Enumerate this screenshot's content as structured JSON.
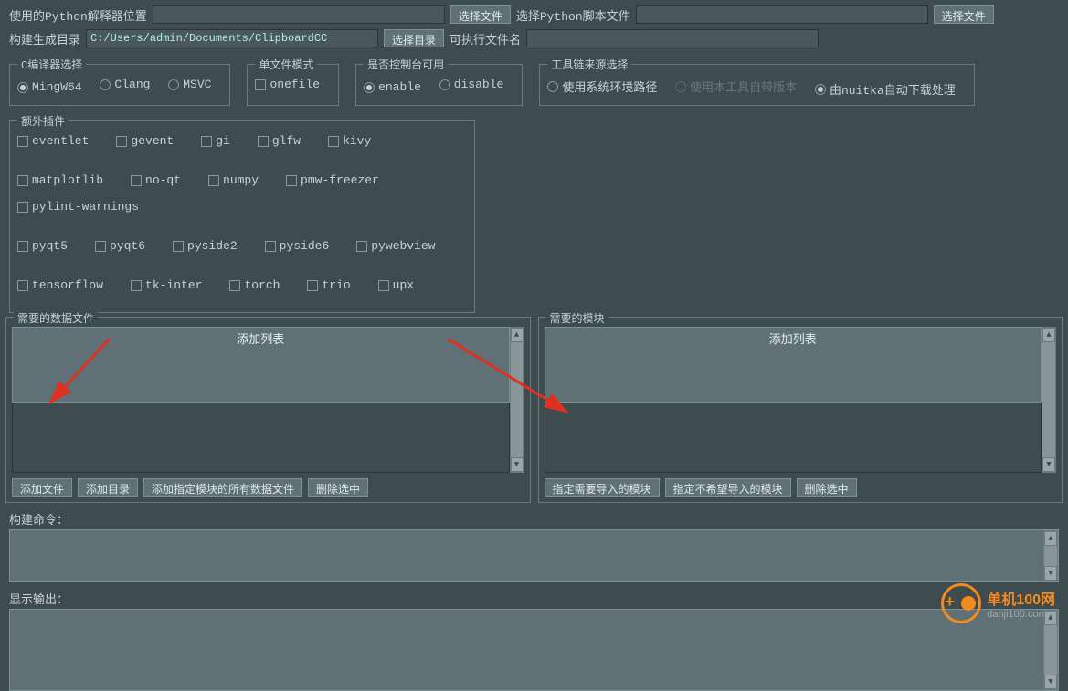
{
  "row1": {
    "python_interp_label": "使用的Python解释器位置",
    "python_interp_value": "",
    "select_file_btn": "选择文件",
    "python_script_label": "选择Python脚本文件",
    "python_script_value": "",
    "select_file_btn2": "选择文件"
  },
  "row2": {
    "build_dir_label": "构建生成目录",
    "build_dir_value": "C:/Users/admin/Documents/ClipboardCC",
    "select_dir_btn": "选择目录",
    "exe_name_label": "可执行文件名",
    "exe_name_value": ""
  },
  "compiler": {
    "legend": "C编译器选择",
    "options": [
      "MingW64",
      "Clang",
      "MSVC"
    ],
    "selected": "MingW64"
  },
  "single_file": {
    "legend": "单文件模式",
    "option": "onefile",
    "checked": false
  },
  "console": {
    "legend": "是否控制台可用",
    "options": [
      "enable",
      "disable"
    ],
    "selected": "enable"
  },
  "toolchain": {
    "legend": "工具链来源选择",
    "opt1": "使用系统环境路径",
    "opt2": "使用本工具自带版本",
    "opt3": "由nuitka自动下载处理",
    "selected": "由nuitka自动下载处理",
    "disabled": "使用本工具自带版本"
  },
  "plugins": {
    "legend": "额外插件",
    "items": [
      "eventlet",
      "gevent",
      "gi",
      "glfw",
      "kivy",
      "matplotlib",
      "no-qt",
      "numpy",
      "pmw-freezer",
      "pylint-warnings",
      "pyqt5",
      "pyqt6",
      "pyside2",
      "pyside6",
      "pywebview",
      "tensorflow",
      "tk-inter",
      "torch",
      "trio",
      "upx"
    ]
  },
  "data_files": {
    "legend": "需要的数据文件",
    "header": "添加列表",
    "btn_add_file": "添加文件",
    "btn_add_dir": "添加目录",
    "btn_add_module": "添加指定模块的所有数据文件",
    "btn_delete": "删除选中"
  },
  "modules": {
    "legend": "需要的模块",
    "header": "添加列表",
    "btn_need": "指定需要导入的模块",
    "btn_not": "指定不希望导入的模块",
    "btn_delete": "删除选中"
  },
  "build_cmd_label": "构建命令：",
  "output_label": "显示输出：",
  "watermark": {
    "title": "单机100网",
    "url": "danji100.com"
  }
}
